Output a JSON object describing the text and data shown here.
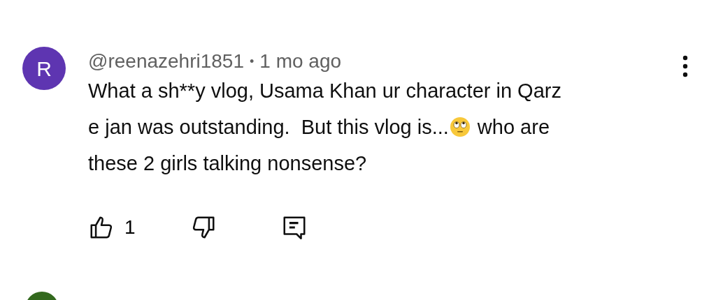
{
  "comments": [
    {
      "avatar": {
        "letter": "R",
        "color": "#5e35b1"
      },
      "author": "@reenazehri1851",
      "separator": "•",
      "time": "1 mo ago",
      "lines": [
        [
          "What a sh**y vlog, Usama Khan ur character in Qarz"
        ],
        [
          "e jan was outstanding.  But this vlog is...",
          "who are"
        ],
        [
          "these 2 girls talking nonsense?"
        ]
      ],
      "likes": "1"
    },
    {
      "avatar": {
        "color": "#33691e"
      }
    }
  ]
}
